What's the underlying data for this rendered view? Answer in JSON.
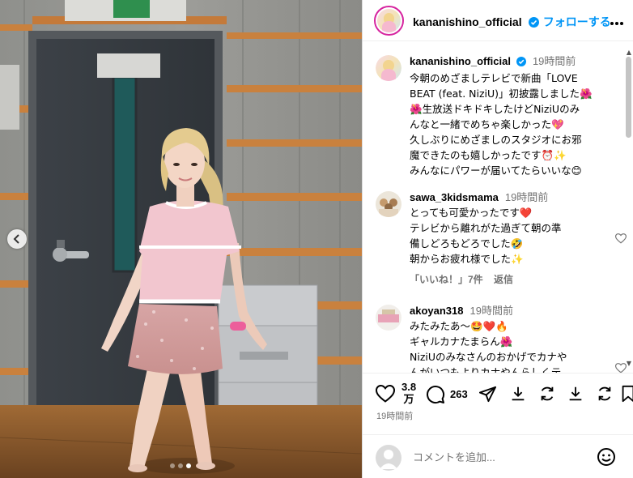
{
  "header": {
    "username": "kananishino_official",
    "verified": true,
    "follow_label": "フォローする",
    "more_label": "..."
  },
  "photo": {
    "slide_count": 3,
    "active_slide": 2,
    "prev_label": "‹"
  },
  "caption": {
    "username": "kananishino_official",
    "time": "19時間前",
    "lines": [
      "今朝のめざましテレビで新曲「LOVE",
      "BEAT (feat. NiziU)」初披露しました🌺",
      "🌺生放送ドキドキしたけどNiziUのみ",
      "んなと一緒でめちゃ楽しかった💖",
      "久しぶりにめざましのスタジオにお邪",
      "魔できたのも嬉しかったです⏰✨",
      "みんなにパワーが届いてたらいいな😊"
    ]
  },
  "comments": [
    {
      "username": "sawa_3kidsmama",
      "time": "19時間前",
      "lines": [
        "とっても可愛かったです❤️",
        "テレビから離れがた過ぎて朝の準",
        "備しどろもどろでした🤣",
        "朝からお疲れ様でした✨"
      ],
      "likes": "「いいね！」7件",
      "reply_label": "返信"
    },
    {
      "username": "akoyan318",
      "time": "19時間前",
      "lines": [
        "みたみたあ〜🤩❤️🔥",
        "ギャルカナたまらん🌺",
        "NiziUのみなさんのおかげでカナや",
        "んがいつもよりカナやんらしくテ"
      ]
    }
  ],
  "actions": {
    "like_count": "3.8",
    "like_unit": "万",
    "comment_count": "263",
    "posted_time": "19時間前"
  },
  "comment_box": {
    "placeholder": "コメントを追加..."
  },
  "colors": {
    "accent": "#0095f6",
    "muted": "#737373",
    "border": "#dbdbdb",
    "scroll_thumb": "#c4c4c4"
  }
}
